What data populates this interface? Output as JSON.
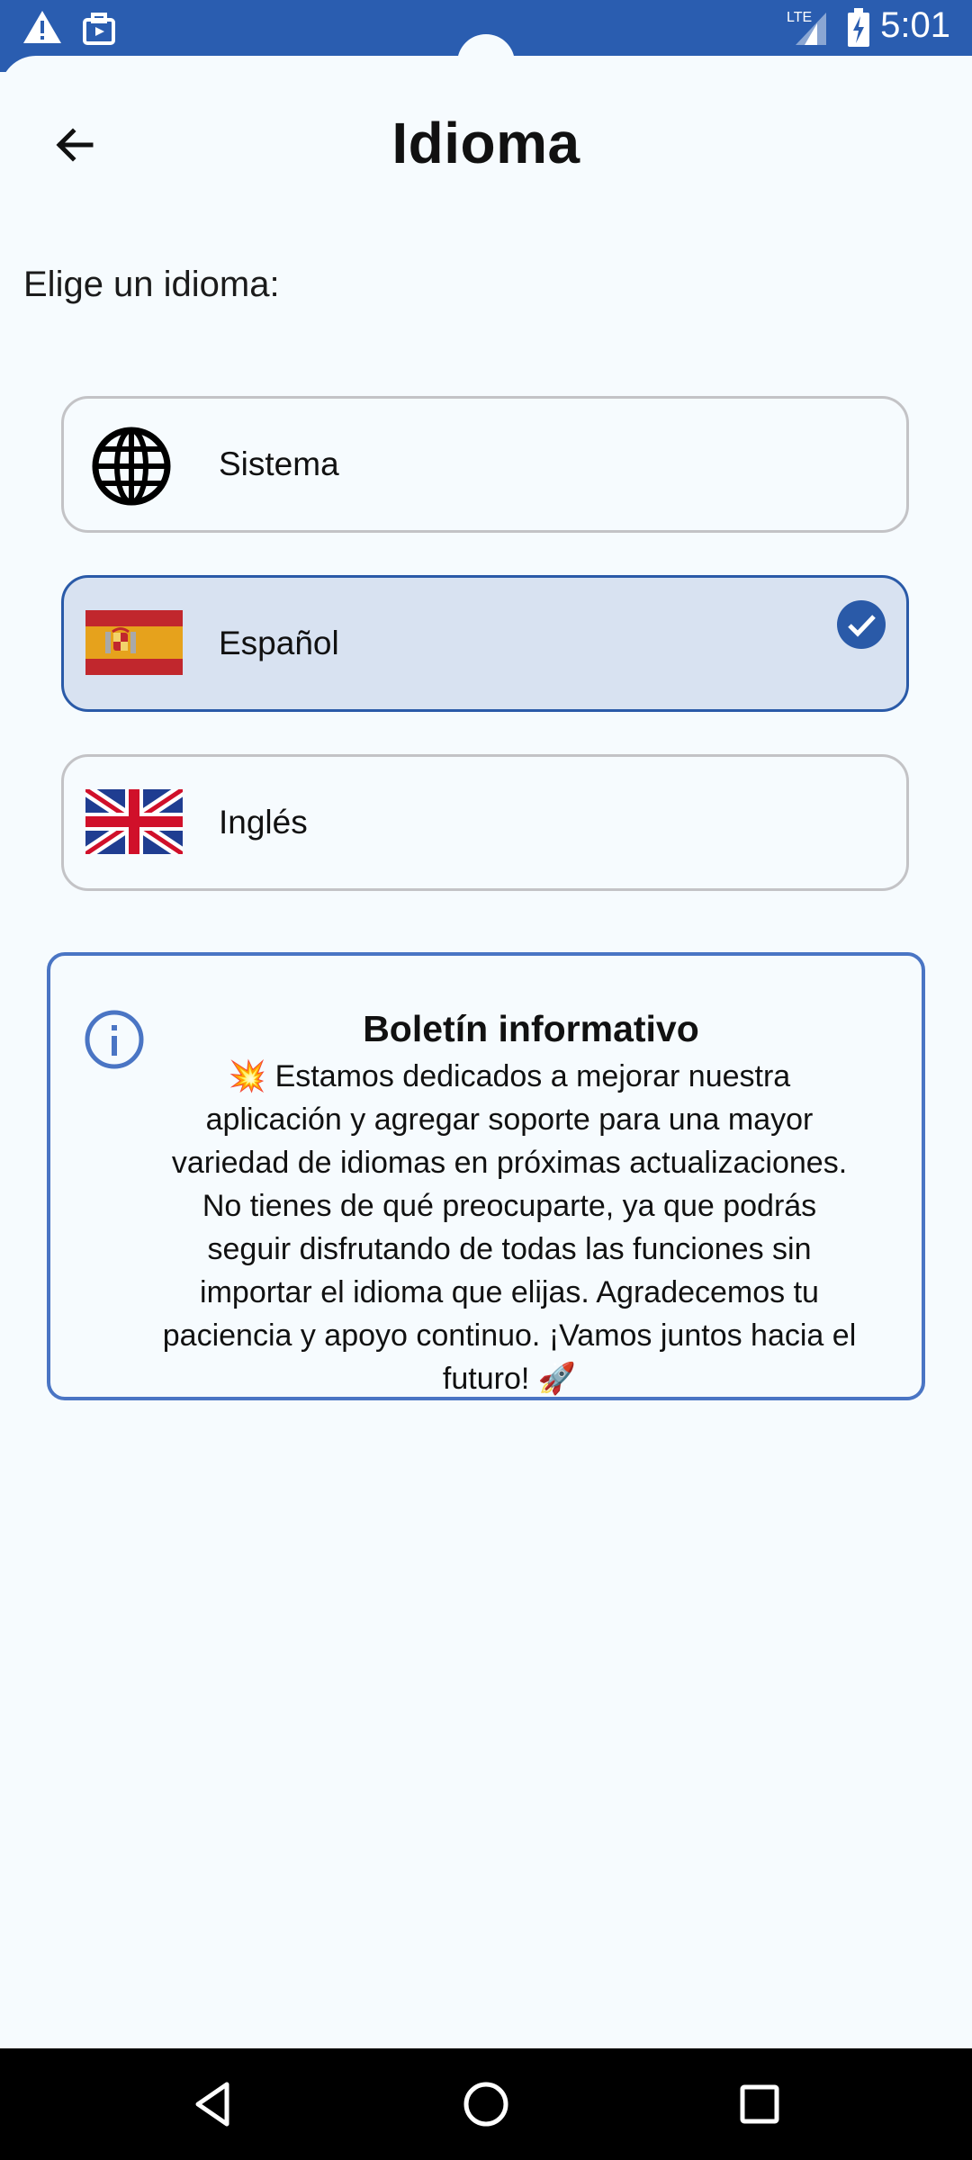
{
  "status_bar": {
    "time": "5:01",
    "icons": [
      "warning-icon",
      "briefcase-icon",
      "lte-signal-icon",
      "battery-charging-icon"
    ],
    "color": "#2a5db0"
  },
  "header": {
    "title": "Idioma",
    "back_icon": "arrow-back-icon"
  },
  "prompt": "Elige un idioma:",
  "options": [
    {
      "label": "Sistema",
      "icon": "globe-icon",
      "selected": false
    },
    {
      "label": "Español",
      "icon": "spain-flag-icon",
      "selected": true
    },
    {
      "label": "Inglés",
      "icon": "uk-flag-icon",
      "selected": false
    }
  ],
  "info_card": {
    "icon": "info-icon",
    "title": "Boletín informativo",
    "text": "💥 Estamos dedicados a mejorar nuestra aplicación y agregar soporte para una mayor variedad de idiomas en próximas actualizaciones. No tienes de qué preocuparte, ya que podrás seguir disfrutando de todas las funciones sin importar el idioma que elijas. Agradecemos tu paciencia y apoyo continuo. ¡Vamos juntos hacia el futuro! 🚀"
  },
  "nav_bar": {
    "buttons": [
      "back-triangle-icon",
      "home-circle-icon",
      "recents-square-icon"
    ]
  },
  "colors": {
    "accent": "#2a5aa8",
    "selected_bg": "#d8e2f1",
    "background": "#f6fbfe"
  }
}
